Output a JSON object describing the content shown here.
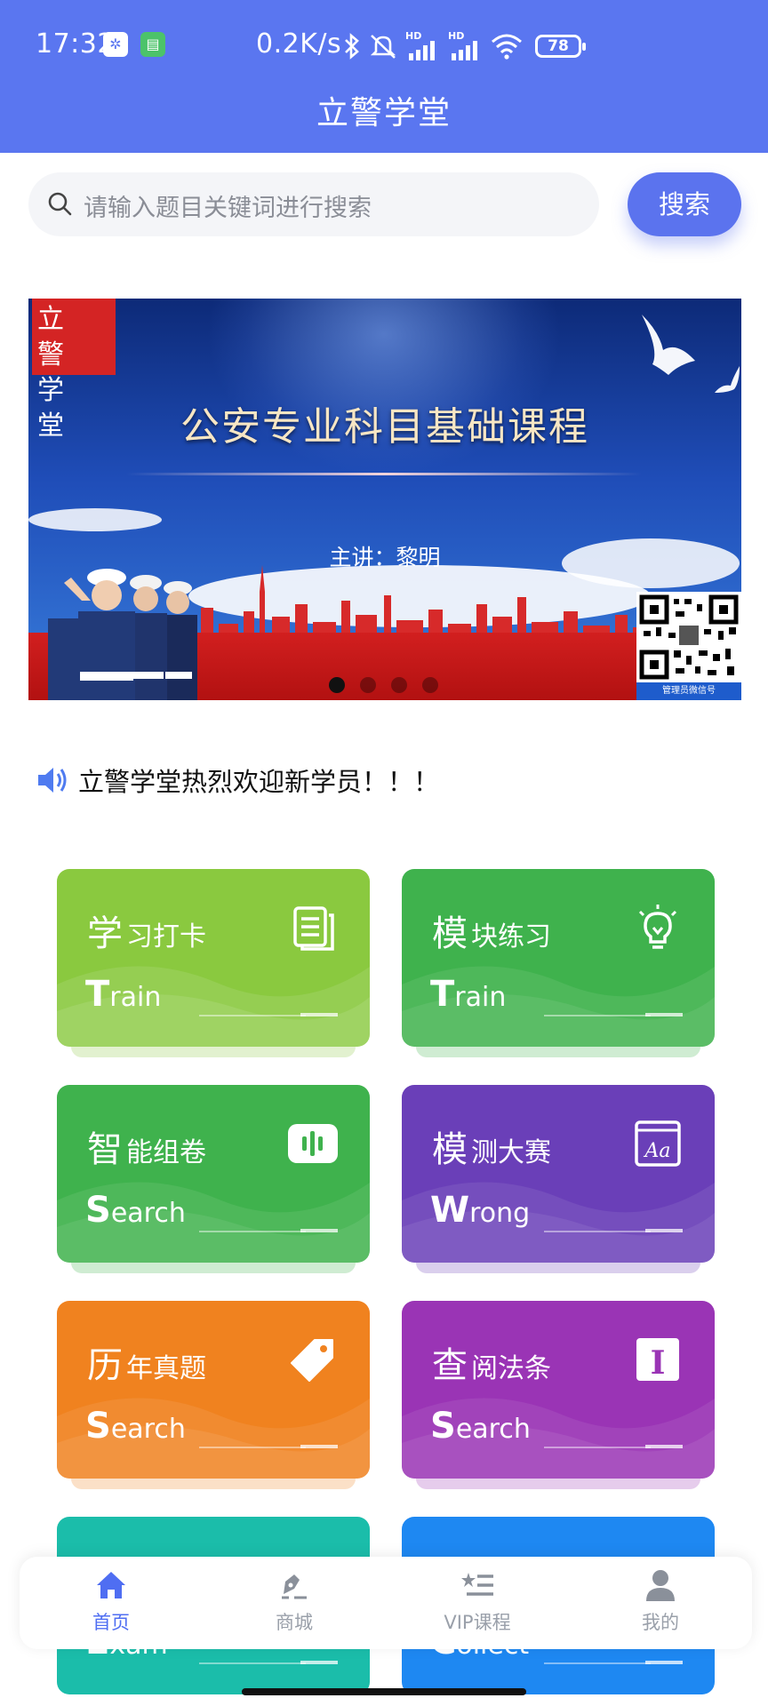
{
  "status_bar": {
    "time": "17:32",
    "net_speed": "0.2K/s",
    "battery": "78",
    "signal_1_label": "HD",
    "signal_2_label": "HD"
  },
  "header": {
    "title": "立警学堂"
  },
  "search": {
    "placeholder": "请输入题目关键词进行搜索",
    "button_label": "搜索"
  },
  "banner": {
    "stamp_text": "立警学堂",
    "headline": "公安专业科目基础课程",
    "lecturer": "主讲：黎明",
    "qr_caption": "管理员微信号",
    "slide_count": 4,
    "active_slide": 1
  },
  "notice": {
    "text": "立警学堂热烈欢迎新学员！！！"
  },
  "cards": [
    {
      "zh_first": "学",
      "zh_rest": "习打卡",
      "en_first": "T",
      "en_rest": "rain",
      "icon": "document-icon",
      "color": "#8ac93f"
    },
    {
      "zh_first": "模",
      "zh_rest": "块练习",
      "en_first": "T",
      "en_rest": "rain",
      "icon": "lightbulb-icon",
      "color": "#3fb24d"
    },
    {
      "zh_first": "智",
      "zh_rest": "能组卷",
      "en_first": "S",
      "en_rest": "earch",
      "icon": "voice-bars-icon",
      "color": "#3fb24d"
    },
    {
      "zh_first": "模",
      "zh_rest": "测大赛",
      "en_first": "W",
      "en_rest": "rong",
      "icon": "font-aa-icon",
      "color": "#6a3fb8"
    },
    {
      "zh_first": "历",
      "zh_rest": "年真题",
      "en_first": "S",
      "en_rest": "earch",
      "icon": "tag-icon",
      "color": "#f0821f"
    },
    {
      "zh_first": "查",
      "zh_rest": "阅法条",
      "en_first": "S",
      "en_rest": "earch",
      "icon": "text-cursor-icon",
      "color": "#9a34b5"
    },
    {
      "zh_first": "",
      "zh_rest": "",
      "en_first": "E",
      "en_rest": "xam",
      "icon": "",
      "color": "#1bbdaa"
    },
    {
      "zh_first": "",
      "zh_rest": "",
      "en_first": "C",
      "en_rest": "ollect",
      "icon": "",
      "color": "#1e88f2"
    }
  ],
  "tabbar": {
    "items": [
      {
        "label": "首页",
        "icon": "home-icon",
        "active": true
      },
      {
        "label": "商城",
        "icon": "shop-pen-icon",
        "active": false
      },
      {
        "label": "VIP课程",
        "icon": "vip-list-icon",
        "active": false
      },
      {
        "label": "我的",
        "icon": "user-icon",
        "active": false
      }
    ]
  }
}
